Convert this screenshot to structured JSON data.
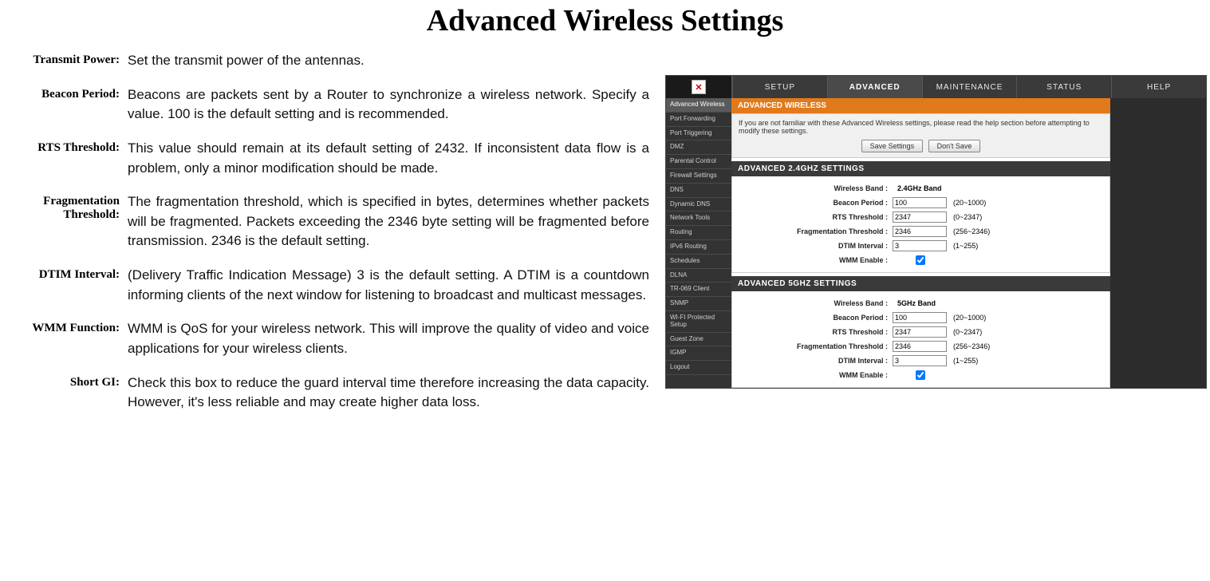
{
  "page": {
    "title": "Advanced Wireless Settings"
  },
  "defs": {
    "transmit_power": {
      "term": "Transmit Power:",
      "desc": "Set the transmit power of the antennas."
    },
    "beacon_period": {
      "term": "Beacon Period:",
      "desc": "Beacons are packets sent by a Router to synchronize a wireless network. Specify a value. 100 is the default setting and is recommended."
    },
    "rts_threshold": {
      "term": "RTS Threshold:",
      "desc": "This value should remain at its default setting of 2432. If inconsistent data flow is a problem, only a minor modification should be made."
    },
    "frag_threshold": {
      "term": "Fragmentation Threshold:",
      "desc": "The fragmentation threshold, which is specified in bytes, determines whether packets will be fragmented. Packets exceeding the 2346 byte setting will be fragmented before transmission. 2346 is the default setting."
    },
    "dtim_interval": {
      "term": "DTIM Interval:",
      "desc": "(Delivery Traffic Indication Message) 3 is the default setting. A DTIM is a countdown informing clients of the next window for listening to broadcast and multicast messages."
    },
    "wmm_function": {
      "term": "WMM Function:",
      "desc": "WMM is QoS for your wireless network. This will improve the quality of video and voice applications for your wireless clients."
    },
    "short_gi": {
      "term": "Short GI:",
      "desc": "Check this box to reduce the guard interval time therefore increasing the data capacity. However, it's less reliable and may create higher data loss."
    }
  },
  "shot": {
    "tabs": {
      "setup": "SETUP",
      "advanced": "ADVANCED",
      "maintenance": "MAINTENANCE",
      "status": "STATUS",
      "help": "HELP"
    },
    "sidebar": [
      "Advanced Wireless",
      "Port Forwarding",
      "Port Triggering",
      "DMZ",
      "Parental Control",
      "Firewall Settings",
      "DNS",
      "Dynamic DNS",
      "Network Tools",
      "Routing",
      "IPv6 Routing",
      "Schedules",
      "DLNA",
      "TR-069 Client",
      "SNMP",
      "WI-FI Protected Setup",
      "Guest Zone",
      "IGMP",
      "Logout"
    ],
    "header": {
      "title": "ADVANCED WIRELESS",
      "notice": "If you are not familiar with these Advanced Wireless settings, please read the help section before attempting to modify these settings.",
      "save": "Save Settings",
      "dont": "Don't Save"
    },
    "s24": {
      "title": "ADVANCED 2.4GHZ SETTINGS",
      "band_label": "Wireless Band :",
      "band_val": "2.4GHz Band",
      "beacon_label": "Beacon Period :",
      "beacon_val": "100",
      "beacon_hint": "(20~1000)",
      "rts_label": "RTS Threshold :",
      "rts_val": "2347",
      "rts_hint": "(0~2347)",
      "frag_label": "Fragmentation Threshold :",
      "frag_val": "2346",
      "frag_hint": "(256~2346)",
      "dtim_label": "DTIM Interval :",
      "dtim_val": "3",
      "dtim_hint": "(1~255)",
      "wmm_label": "WMM Enable :"
    },
    "s5": {
      "title": "ADVANCED 5GHZ SETTINGS",
      "band_label": "Wireless Band :",
      "band_val": "5GHz Band",
      "beacon_label": "Beacon Period :",
      "beacon_val": "100",
      "beacon_hint": "(20~1000)",
      "rts_label": "RTS Threshold :",
      "rts_val": "2347",
      "rts_hint": "(0~2347)",
      "frag_label": "Fragmentation Threshold :",
      "frag_val": "2346",
      "frag_hint": "(256~2346)",
      "dtim_label": "DTIM Interval :",
      "dtim_val": "3",
      "dtim_hint": "(1~255)",
      "wmm_label": "WMM Enable :"
    }
  }
}
